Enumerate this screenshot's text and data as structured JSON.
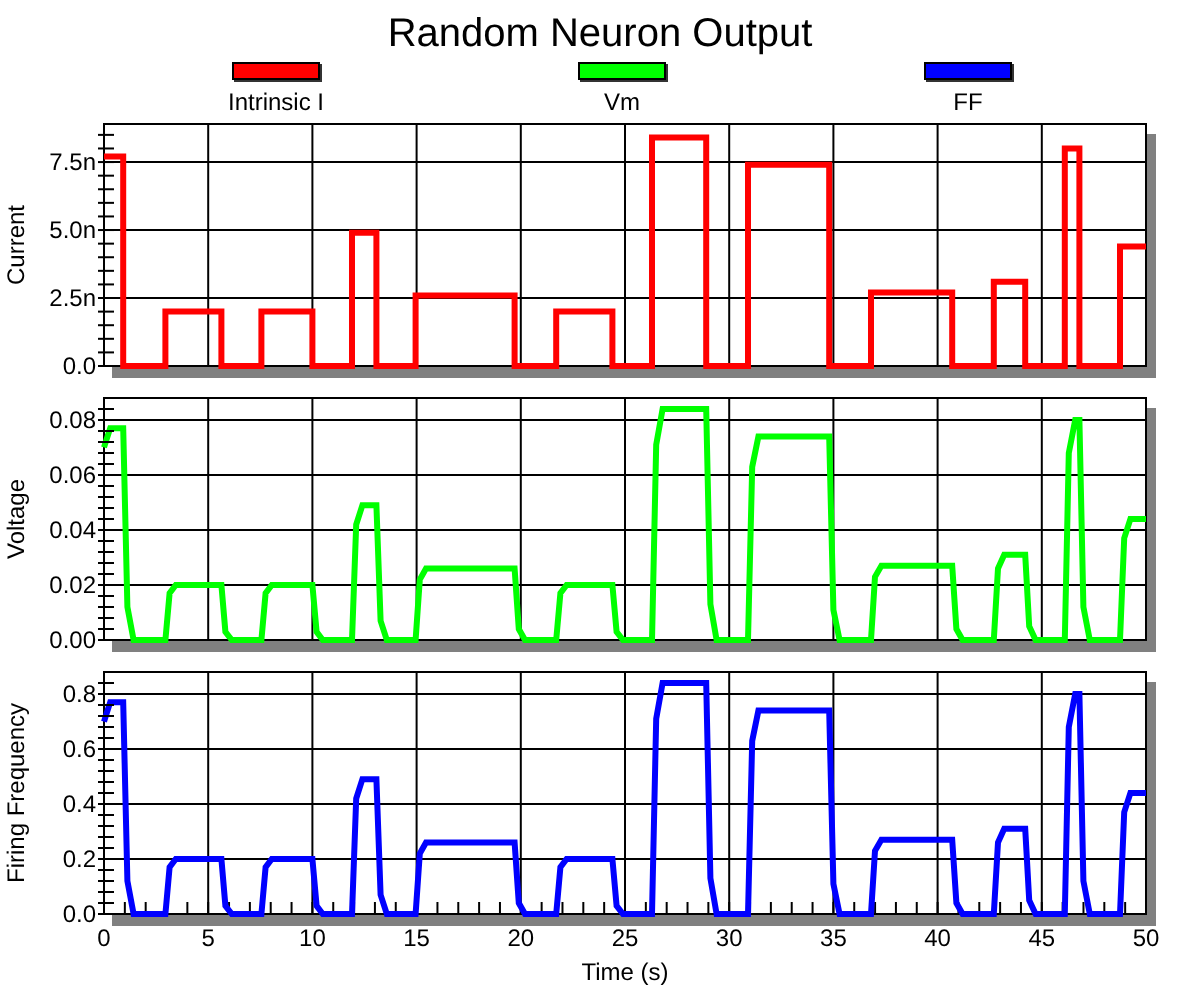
{
  "title": "Random Neuron Output",
  "legend": [
    {
      "label": "Intrinsic I",
      "color": "#ff0000"
    },
    {
      "label": "Vm",
      "color": "#00ff00"
    },
    {
      "label": "FF",
      "color": "#0000ff"
    }
  ],
  "panels": [
    {
      "chart_data": {
        "type": "line",
        "grid": true,
        "ylabel": "Current",
        "xlim": [
          0,
          50
        ],
        "ylim": [
          0,
          8.9
        ],
        "yticks": [
          {
            "value": 0,
            "label": "0.0"
          },
          {
            "value": 2.5,
            "label": "2.5n"
          },
          {
            "value": 5,
            "label": "5.0n"
          },
          {
            "value": 7.5,
            "label": "7.5n"
          }
        ],
        "x": [
          0,
          0.92,
          0.92,
          2.95,
          2.95,
          5.63,
          5.63,
          7.55,
          7.55,
          10,
          10,
          11.9,
          11.9,
          13.07,
          13.07,
          14.95,
          14.95,
          19.7,
          19.7,
          21.7,
          21.7,
          24.4,
          24.4,
          26.3,
          26.3,
          28.9,
          28.9,
          30.9,
          30.9,
          34.8,
          34.8,
          36.8,
          36.8,
          40.7,
          40.7,
          42.7,
          42.7,
          44.2,
          44.2,
          46.1,
          46.1,
          46.8,
          46.8,
          48.75,
          48.75,
          50
        ],
        "series": [
          {
            "color": "#ff0000",
            "values": [
              7.7,
              7.7,
              0,
              0,
              2,
              2,
              0,
              0,
              2,
              2,
              0,
              0,
              4.9,
              4.9,
              0,
              0,
              2.6,
              2.6,
              0,
              0,
              2,
              2,
              0,
              0,
              8.4,
              8.4,
              0,
              0,
              7.4,
              7.4,
              0,
              0,
              2.7,
              2.7,
              0,
              0,
              3.1,
              3.1,
              0,
              0,
              8,
              8,
              0,
              0,
              4.4,
              4.4
            ]
          }
        ]
      }
    },
    {
      "chart_data": {
        "type": "line",
        "grid": true,
        "ylabel": "Voltage",
        "xlim": [
          0,
          50
        ],
        "ylim": [
          0,
          0.088
        ],
        "yticks": [
          {
            "value": 0,
            "label": "0.00"
          },
          {
            "value": 0.02,
            "label": "0.02"
          },
          {
            "value": 0.04,
            "label": "0.04"
          },
          {
            "value": 0.06,
            "label": "0.06"
          },
          {
            "value": 0.08,
            "label": "0.08"
          }
        ],
        "x": [
          0,
          0.3,
          0.92,
          1.12,
          1.42,
          2.95,
          3.15,
          3.45,
          5.63,
          5.83,
          6.13,
          7.55,
          7.75,
          8.05,
          10,
          10.2,
          10.5,
          11.9,
          12.1,
          12.4,
          13.07,
          13.27,
          13.57,
          14.95,
          15.15,
          15.45,
          19.7,
          19.9,
          20.2,
          21.7,
          21.9,
          22.2,
          24.4,
          24.6,
          24.9,
          26.3,
          26.5,
          26.8,
          28.9,
          29.1,
          29.4,
          30.9,
          31.1,
          31.4,
          34.8,
          35,
          35.3,
          36.8,
          37,
          37.3,
          40.7,
          40.9,
          41.2,
          42.7,
          42.9,
          43.2,
          44.2,
          44.4,
          44.7,
          46.1,
          46.3,
          46.6,
          46.8,
          47,
          47.3,
          48.75,
          48.95,
          49.25,
          50
        ],
        "series": [
          {
            "color": "#00ff00",
            "values": [
              0.07,
              0.077,
              0.077,
              0.012,
              0,
              0,
              0.017,
              0.02,
              0.02,
              0.003,
              0,
              0,
              0.017,
              0.02,
              0.02,
              0.003,
              0,
              0,
              0.042,
              0.049,
              0.049,
              0.007,
              0,
              0,
              0.022,
              0.026,
              0.026,
              0.004,
              0,
              0,
              0.017,
              0.02,
              0.02,
              0.003,
              0,
              0,
              0.071,
              0.084,
              0.084,
              0.013,
              0,
              0,
              0.063,
              0.074,
              0.074,
              0.011,
              0,
              0,
              0.023,
              0.027,
              0.027,
              0.004,
              0,
              0,
              0.026,
              0.031,
              0.031,
              0.005,
              0,
              0,
              0.068,
              0.08,
              0.08,
              0.012,
              0,
              0,
              0.037,
              0.044,
              0.044
            ]
          }
        ]
      }
    },
    {
      "chart_data": {
        "type": "line",
        "grid": true,
        "xlabel": "Time (s)",
        "ylabel": "Firing Frequency",
        "xlim": [
          0,
          50
        ],
        "ylim": [
          0,
          0.88
        ],
        "xticks": [
          0,
          5,
          10,
          15,
          20,
          25,
          30,
          35,
          40,
          45,
          50
        ],
        "yticks": [
          {
            "value": 0,
            "label": "0.0"
          },
          {
            "value": 0.2,
            "label": "0.2"
          },
          {
            "value": 0.4,
            "label": "0.4"
          },
          {
            "value": 0.6,
            "label": "0.6"
          },
          {
            "value": 0.8,
            "label": "0.8"
          }
        ],
        "x": [
          0,
          0.3,
          0.92,
          1.12,
          1.42,
          2.95,
          3.15,
          3.45,
          5.63,
          5.83,
          6.13,
          7.55,
          7.75,
          8.05,
          10,
          10.2,
          10.5,
          11.9,
          12.1,
          12.4,
          13.07,
          13.27,
          13.57,
          14.95,
          15.15,
          15.45,
          19.7,
          19.9,
          20.2,
          21.7,
          21.9,
          22.2,
          24.4,
          24.6,
          24.9,
          26.3,
          26.5,
          26.8,
          28.9,
          29.1,
          29.4,
          30.9,
          31.1,
          31.4,
          34.8,
          35,
          35.3,
          36.8,
          37,
          37.3,
          40.7,
          40.9,
          41.2,
          42.7,
          42.9,
          43.2,
          44.2,
          44.4,
          44.7,
          46.1,
          46.3,
          46.6,
          46.8,
          47,
          47.3,
          48.75,
          48.95,
          49.25,
          50
        ],
        "series": [
          {
            "color": "#0000ff",
            "values": [
              0.7,
              0.77,
              0.77,
              0.12,
              0,
              0,
              0.17,
              0.2,
              0.2,
              0.03,
              0,
              0,
              0.17,
              0.2,
              0.2,
              0.03,
              0,
              0,
              0.42,
              0.49,
              0.49,
              0.07,
              0,
              0,
              0.22,
              0.26,
              0.26,
              0.04,
              0,
              0,
              0.17,
              0.2,
              0.2,
              0.03,
              0,
              0,
              0.71,
              0.84,
              0.84,
              0.13,
              0,
              0,
              0.63,
              0.74,
              0.74,
              0.11,
              0,
              0,
              0.23,
              0.27,
              0.27,
              0.04,
              0,
              0,
              0.26,
              0.31,
              0.31,
              0.05,
              0,
              0,
              0.68,
              0.8,
              0.8,
              0.12,
              0,
              0,
              0.37,
              0.44,
              0.44
            ]
          }
        ]
      }
    }
  ]
}
